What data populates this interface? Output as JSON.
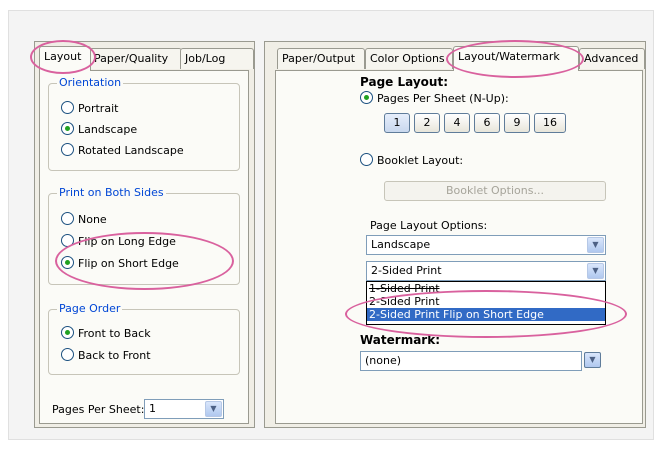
{
  "left": {
    "tabs": [
      {
        "label": "Layout",
        "active": true
      },
      {
        "label": "Paper/Quality",
        "active": false
      },
      {
        "label": "Job/Log",
        "active": false
      }
    ],
    "orientation": {
      "legend": "Orientation",
      "options": [
        {
          "label": "Portrait",
          "checked": false
        },
        {
          "label": "Landscape",
          "checked": true
        },
        {
          "label": "Rotated Landscape",
          "checked": false
        }
      ]
    },
    "both_sides": {
      "legend": "Print on Both Sides",
      "options": [
        {
          "label": "None",
          "checked": false
        },
        {
          "label": "Flip on Long Edge",
          "checked": false
        },
        {
          "label": "Flip on Short Edge",
          "checked": true
        }
      ]
    },
    "page_order": {
      "legend": "Page Order",
      "options": [
        {
          "label": "Front to Back",
          "checked": true
        },
        {
          "label": "Back to Front",
          "checked": false
        }
      ]
    },
    "pages_per_sheet": {
      "label": "Pages Per Sheet:",
      "value": "1"
    }
  },
  "right": {
    "tabs": [
      {
        "label": "Paper/Output",
        "active": false
      },
      {
        "label": "Color Options",
        "active": false
      },
      {
        "label": "Layout/Watermark",
        "active": true
      },
      {
        "label": "Advanced",
        "active": false
      }
    ],
    "page_layout_heading": "Page Layout:",
    "pages_per_sheet_radio": "Pages Per Sheet (N-Up):",
    "nup_buttons": [
      "1",
      "2",
      "4",
      "6",
      "9",
      "16"
    ],
    "nup_selected": "1",
    "booklet_radio": "Booklet Layout:",
    "booklet_button": "Booklet Options...",
    "options_label": "Page Layout Options:",
    "orientation_value": "Landscape",
    "sided_value": "2-Sided Print",
    "dropdown_items": [
      "1-Sided Print",
      "2-Sided Print",
      "2-Sided Print Flip on Short Edge"
    ],
    "dropdown_highlight": "2-Sided Print Flip on Short Edge",
    "watermark_heading": "Watermark:",
    "watermark_value": "(none)"
  },
  "colors": {
    "highlight_oval": "#d9619e",
    "legend_blue": "#0046d5",
    "selection_blue": "#316ac5"
  },
  "icons": {
    "combo_arrow": "chevron-down-icon",
    "radio": "radio-button-icon"
  }
}
